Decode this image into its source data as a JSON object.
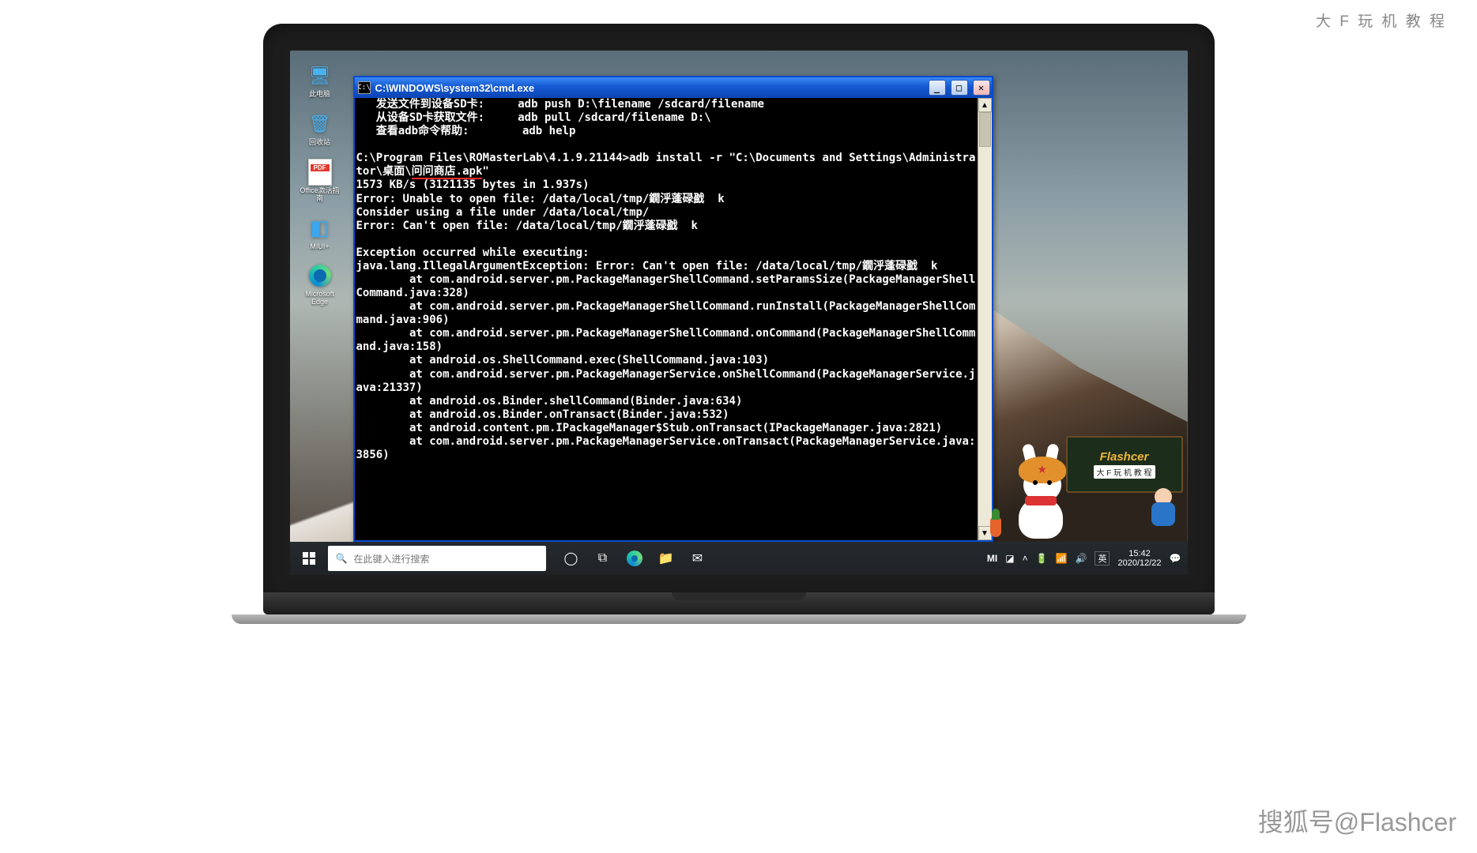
{
  "watermark_top": "大 F 玩 机 教 程",
  "watermark_bottom": "搜狐号@Flashcer",
  "desktop": {
    "icons": [
      {
        "name": "this-pc",
        "label": "此电脑",
        "glyph": "🖥"
      },
      {
        "name": "recycle-bin",
        "label": "回收站",
        "glyph": "🗑"
      },
      {
        "name": "office-pdf",
        "label": "Office激活指南",
        "glyph": "pdf"
      },
      {
        "name": "miui-plus",
        "label": "MIUI+",
        "glyph": "◧"
      },
      {
        "name": "edge",
        "label": "Microsoft Edge",
        "glyph": "edge"
      }
    ]
  },
  "cmd": {
    "title": "C:\\WINDOWS\\system32\\cmd.exe",
    "help": [
      "   发送文件到设备SD卡:     adb push D:\\filename /sdcard/filename",
      "   从设备SD卡获取文件:     adb pull /sdcard/filename D:\\",
      "   查看adb命令帮助:        adb help",
      ""
    ],
    "prompt_pre": "C:\\Program Files\\ROMasterLab\\4.1.9.21144>adb install -r \"C:\\Documents and Settings\\Administrator\\桌面\\",
    "apk": "问问商店.apk",
    "prompt_post": "\"",
    "after": [
      "1573 KB/s (3121135 bytes in 1.937s)",
      "Error: Unable to open file: /data/local/tmp/鐗泘蓬碌戤  k",
      "Consider using a file under /data/local/tmp/",
      "Error: Can't open file: /data/local/tmp/鐗泘蓬碌戤  k",
      "",
      "Exception occurred while executing:",
      "java.lang.IllegalArgumentException: Error: Can't open file: /data/local/tmp/鐗泘蓬碌戤  k",
      "        at com.android.server.pm.PackageManagerShellCommand.setParamsSize(PackageManagerShellCommand.java:328)",
      "        at com.android.server.pm.PackageManagerShellCommand.runInstall(PackageManagerShellCommand.java:906)",
      "        at com.android.server.pm.PackageManagerShellCommand.onCommand(PackageManagerShellCommand.java:158)",
      "        at android.os.ShellCommand.exec(ShellCommand.java:103)",
      "        at com.android.server.pm.PackageManagerService.onShellCommand(PackageManagerService.java:21337)",
      "        at android.os.Binder.shellCommand(Binder.java:634)",
      "        at android.os.Binder.onTransact(Binder.java:532)",
      "        at android.content.pm.IPackageManager$Stub.onTransact(IPackageManager.java:2821)",
      "        at com.android.server.pm.PackageManagerService.onTransact(PackageManagerService.java:3856)"
    ]
  },
  "mascot": {
    "brand": "Flashcer",
    "sub": "大 F 玩 机 教 程"
  },
  "taskbar": {
    "search_placeholder": "在此键入进行搜索",
    "lang": "英",
    "time": "15:42",
    "date": "2020/12/22",
    "mi": "MI",
    "icons": [
      "cortana",
      "task-view",
      "edge",
      "explorer",
      "mail"
    ]
  }
}
